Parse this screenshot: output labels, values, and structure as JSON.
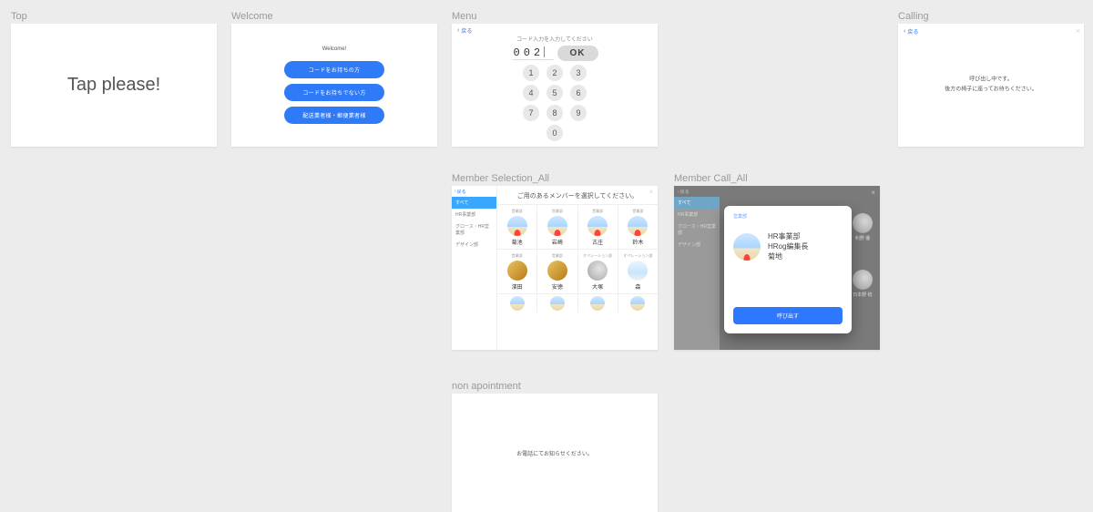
{
  "top": {
    "label": "Top",
    "message": "Tap please!"
  },
  "welcome": {
    "label": "Welcome",
    "title": "Welcome!",
    "buttons": [
      "コードをお持ちの方",
      "コードをお持ちでない方",
      "配送業者様・郵便業者様"
    ]
  },
  "menu": {
    "label": "Menu",
    "back": "戻る",
    "prompt": "コード入力を入力してください",
    "code": "002",
    "ok": "OK",
    "keys": [
      [
        "1",
        "2",
        "3"
      ],
      [
        "4",
        "5",
        "6"
      ],
      [
        "7",
        "8",
        "9"
      ],
      [
        "0"
      ]
    ]
  },
  "calling": {
    "label": "Calling",
    "back": "戻る",
    "line1": "呼び出し中です。",
    "line2": "後方の椅子に座ってお待ちください。"
  },
  "msel": {
    "label": "Member Selection_All",
    "back": "戻る",
    "header": "ご用のあるメンバーを選択してください。",
    "tabs": [
      "すべて",
      "HR事業部",
      "グロース・HR営業部",
      "デザイン部"
    ],
    "rows": [
      [
        {
          "role": "営業部",
          "name": "菊池"
        },
        {
          "role": "営業部",
          "name": "岩崎"
        },
        {
          "role": "営業部",
          "name": "古庄"
        },
        {
          "role": "営業部",
          "name": "鈴木"
        }
      ],
      [
        {
          "role": "営業部",
          "name": "濱田"
        },
        {
          "role": "営業部",
          "name": "安徳"
        },
        {
          "role": "オペレーション部",
          "name": "大塚"
        },
        {
          "role": "オペレーション部",
          "name": "森"
        }
      ]
    ]
  },
  "mcall": {
    "label": "Member Call_All",
    "back": "戻る",
    "tabs": [
      "すべて",
      "HR事業部",
      "グロース・HR営業部",
      "デザイン部"
    ],
    "bg_members": [
      {
        "name": "利野 優"
      },
      {
        "name": "日本野 稔"
      }
    ],
    "dialog": {
      "role": "営業部",
      "lines": [
        "HR事業部",
        "HRog編集長",
        "菊地"
      ],
      "button": "呼び出す"
    }
  },
  "nonap": {
    "label": "non apointment",
    "message": "お電話にてお知らせください。"
  }
}
